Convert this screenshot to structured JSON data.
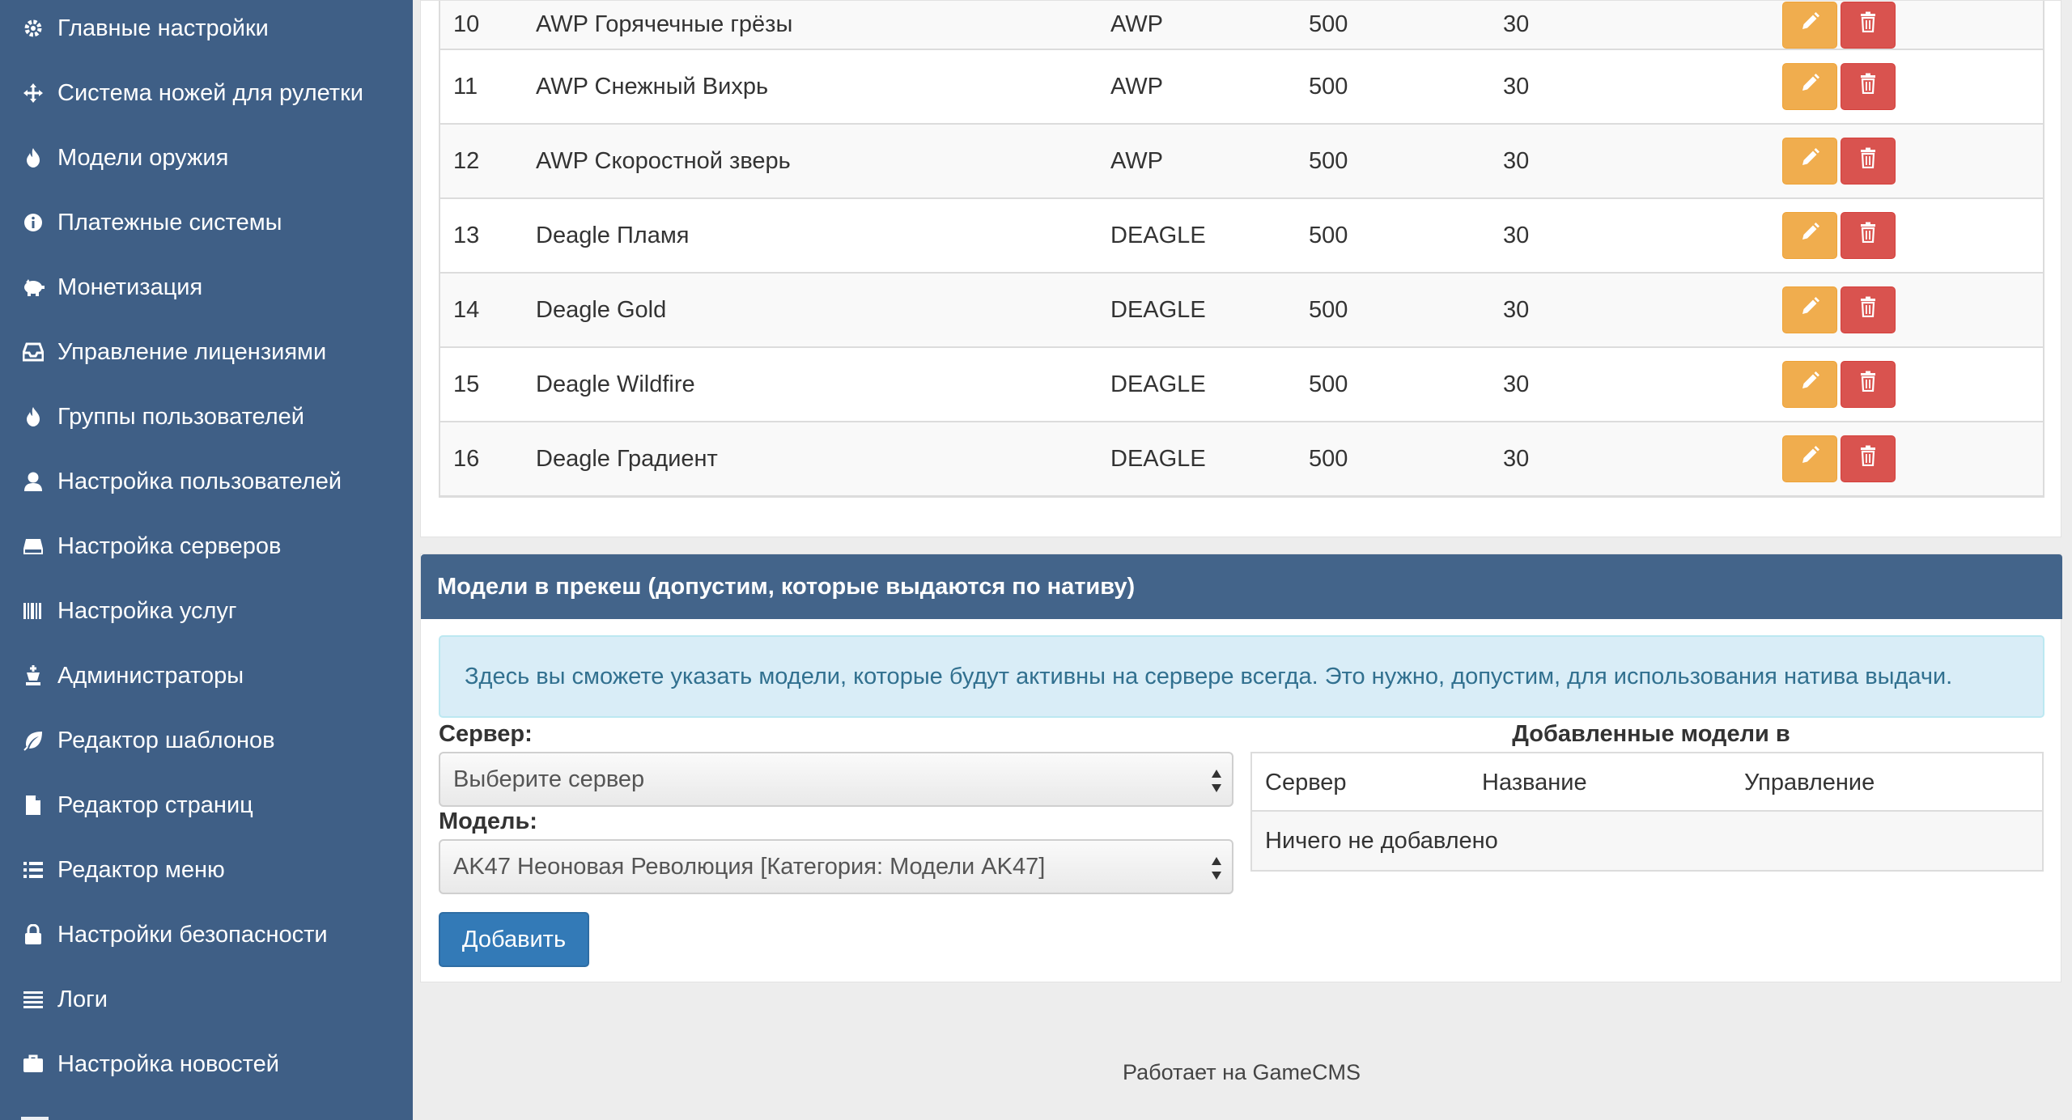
{
  "sidebar": {
    "items": [
      {
        "label": "Главные настройки",
        "icon": "gear-icon"
      },
      {
        "label": "Система ножей для рулетки",
        "icon": "move-icon"
      },
      {
        "label": "Модели оружия",
        "icon": "fire-icon"
      },
      {
        "label": "Платежные системы",
        "icon": "info-icon"
      },
      {
        "label": "Монетизация",
        "icon": "piggy-bank-icon"
      },
      {
        "label": "Управление лицензиями",
        "icon": "inbox-icon"
      },
      {
        "label": "Группы пользователей",
        "icon": "fire-icon"
      },
      {
        "label": "Настройка пользователей",
        "icon": "user-icon"
      },
      {
        "label": "Настройка серверов",
        "icon": "hdd-icon"
      },
      {
        "label": "Настройка услуг",
        "icon": "barcode-icon"
      },
      {
        "label": "Администраторы",
        "icon": "king-icon"
      },
      {
        "label": "Редактор шаблонов",
        "icon": "leaf-icon"
      },
      {
        "label": "Редактор страниц",
        "icon": "file-icon"
      },
      {
        "label": "Редактор меню",
        "icon": "list-icon"
      },
      {
        "label": "Настройки безопасности",
        "icon": "lock-icon"
      },
      {
        "label": "Логи",
        "icon": "align-justify-icon"
      },
      {
        "label": "Настройка новостей",
        "icon": "briefcase-icon"
      }
    ]
  },
  "models_table": {
    "rows": [
      {
        "id": "10",
        "name": "AWP Горячечные грёзы",
        "weapon": "AWP",
        "price": "500",
        "term": "30"
      },
      {
        "id": "11",
        "name": "AWP Снежный Вихрь",
        "weapon": "AWP",
        "price": "500",
        "term": "30"
      },
      {
        "id": "12",
        "name": "AWP Скоростной зверь",
        "weapon": "AWP",
        "price": "500",
        "term": "30"
      },
      {
        "id": "13",
        "name": "Deagle Пламя",
        "weapon": "DEAGLE",
        "price": "500",
        "term": "30"
      },
      {
        "id": "14",
        "name": "Deagle Gold",
        "weapon": "DEAGLE",
        "price": "500",
        "term": "30"
      },
      {
        "id": "15",
        "name": "Deagle Wildfire",
        "weapon": "DEAGLE",
        "price": "500",
        "term": "30"
      },
      {
        "id": "16",
        "name": "Deagle Градиент",
        "weapon": "DEAGLE",
        "price": "500",
        "term": "30"
      }
    ]
  },
  "cache_panel": {
    "title": "Модели в прекеш (допустим, которые выдаются по нативу)",
    "info": "Здесь вы сможете указать модели, которые будут активны на сервере всегда. Это нужно, допустим, для использования натива выдачи.",
    "server_label": "Сервер:",
    "server_value": "Выберите сервер",
    "model_label": "Модель:",
    "model_value": "AK47 Неоновая Революция [Категория: Модели AK47]",
    "add_button": "Добавить",
    "added_title": "Добавленные модели в прекеш",
    "added_columns": [
      "Сервер",
      "Название",
      "Управление"
    ],
    "added_empty": "Ничего не добавлено"
  },
  "footer": {
    "text": "Работает на GameCMS"
  },
  "colors": {
    "sidebar": "#3f5f86",
    "panel_header": "#43648a",
    "edit": "#f0ad4e",
    "delete": "#d9534f",
    "primary": "#337ab7"
  }
}
